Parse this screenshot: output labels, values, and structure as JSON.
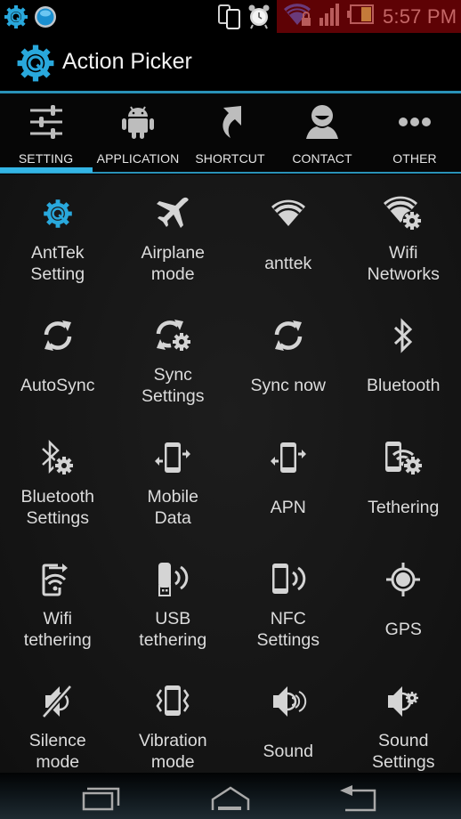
{
  "status_bar": {
    "time": "5:57 PM",
    "icons": [
      "anttek-gear-icon",
      "blue-orb-icon",
      "phone-sync-icon",
      "alarm-clock-icon",
      "wifi-lock-icon",
      "signal-bars-icon",
      "battery-icon"
    ],
    "highlight_color": "#5e0205"
  },
  "action_bar": {
    "title": "Action Picker",
    "icon": "anttek-gear-icon",
    "accent_color": "#33b5e5"
  },
  "tabs": [
    {
      "label": "SETTING",
      "icon": "sliders-icon",
      "selected": true
    },
    {
      "label": "APPLICATION",
      "icon": "android-icon",
      "selected": false
    },
    {
      "label": "SHORTCUT",
      "icon": "shortcut-arrow-icon",
      "selected": false
    },
    {
      "label": "CONTACT",
      "icon": "contact-person-icon",
      "selected": false
    },
    {
      "label": "OTHER",
      "icon": "more-dots-icon",
      "selected": false
    }
  ],
  "actions": [
    {
      "label": "AntTek\nSetting",
      "icon": "anttek-gear-icon"
    },
    {
      "label": "Airplane\nmode",
      "icon": "airplane-icon"
    },
    {
      "label": "anttek",
      "icon": "wifi-icon"
    },
    {
      "label": "Wifi\nNetworks",
      "icon": "wifi-settings-icon"
    },
    {
      "label": "AutoSync",
      "icon": "sync-icon"
    },
    {
      "label": "Sync\nSettings",
      "icon": "sync-settings-icon"
    },
    {
      "label": "Sync now",
      "icon": "sync-now-icon"
    },
    {
      "label": "Bluetooth",
      "icon": "bluetooth-icon"
    },
    {
      "label": "Bluetooth\nSettings",
      "icon": "bluetooth-settings-icon"
    },
    {
      "label": "Mobile\nData",
      "icon": "mobile-data-icon"
    },
    {
      "label": "APN",
      "icon": "apn-icon"
    },
    {
      "label": "Tethering",
      "icon": "tethering-settings-icon"
    },
    {
      "label": "Wifi\ntethering",
      "icon": "wifi-tethering-icon"
    },
    {
      "label": "USB\ntethering",
      "icon": "usb-tethering-icon"
    },
    {
      "label": "NFC\nSettings",
      "icon": "nfc-icon"
    },
    {
      "label": "GPS",
      "icon": "gps-icon"
    },
    {
      "label": "Silence\nmode",
      "icon": "speaker-muted-icon"
    },
    {
      "label": "Vibration\nmode",
      "icon": "vibration-icon"
    },
    {
      "label": "Sound",
      "icon": "speaker-sound-icon"
    },
    {
      "label": "Sound\nSettings",
      "icon": "speaker-settings-icon"
    }
  ],
  "nav_bar": {
    "buttons": [
      "recent-apps-icon",
      "home-icon",
      "back-icon"
    ]
  }
}
